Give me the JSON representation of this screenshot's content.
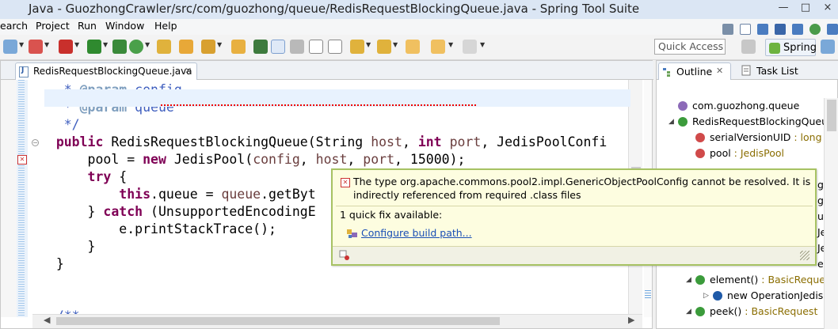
{
  "window": {
    "title": "Java - GuozhongCrawler/src/com/guozhong/queue/RedisRequestBlockingQueue.java - Spring Tool Suite",
    "min": "—",
    "max": "□",
    "close": "×"
  },
  "menu": {
    "items": [
      "earch",
      "Project",
      "Run",
      "Window",
      "Help"
    ]
  },
  "toolbar": {
    "quick_access": "Quick Access",
    "spring": "Spring"
  },
  "editor": {
    "tab_label": "RedisRequestBlockingQueue.java",
    "tab_close": "✕",
    "code_lines": [
      {
        "indent": "    ",
        "parts": [
          {
            "t": "* ",
            "c": "jd"
          },
          {
            "t": "@param",
            "c": "jdtag"
          },
          {
            "t": " config",
            "c": "jd"
          }
        ]
      },
      {
        "indent": "    ",
        "parts": [
          {
            "t": "* ",
            "c": "jd"
          },
          {
            "t": "@param",
            "c": "jdtag"
          },
          {
            "t": " queue",
            "c": "jd"
          }
        ]
      },
      {
        "indent": "    ",
        "parts": [
          {
            "t": "*/",
            "c": "jd"
          }
        ]
      },
      {
        "indent": "   ",
        "parts": [
          {
            "t": "public",
            "c": "kw"
          },
          {
            "t": " RedisRequestBlockingQueue(String ",
            "c": ""
          },
          {
            "t": "host",
            "c": "param"
          },
          {
            "t": ", ",
            "c": ""
          },
          {
            "t": "int",
            "c": "kw"
          },
          {
            "t": " ",
            "c": ""
          },
          {
            "t": "port",
            "c": "param"
          },
          {
            "t": ", JedisPoolConfi",
            "c": ""
          }
        ]
      },
      {
        "indent": "       ",
        "parts": [
          {
            "t": "pool = ",
            "c": ""
          },
          {
            "t": "new",
            "c": "kw"
          },
          {
            "t": " JedisPool(",
            "c": ""
          },
          {
            "t": "config",
            "c": "param"
          },
          {
            "t": ", ",
            "c": ""
          },
          {
            "t": "host",
            "c": "param"
          },
          {
            "t": ", ",
            "c": ""
          },
          {
            "t": "port",
            "c": "param"
          },
          {
            "t": ", 15000);",
            "c": ""
          }
        ]
      },
      {
        "indent": "       ",
        "parts": [
          {
            "t": "try",
            "c": "kw"
          },
          {
            "t": " {",
            "c": ""
          }
        ]
      },
      {
        "indent": "           ",
        "parts": [
          {
            "t": "this",
            "c": "kw"
          },
          {
            "t": ".queue = ",
            "c": ""
          },
          {
            "t": "queue",
            "c": "param"
          },
          {
            "t": ".getByt",
            "c": ""
          }
        ]
      },
      {
        "indent": "       ",
        "parts": [
          {
            "t": "} ",
            "c": ""
          },
          {
            "t": "catch",
            "c": "kw"
          },
          {
            "t": " (UnsupportedEncodingE",
            "c": ""
          }
        ]
      },
      {
        "indent": "           ",
        "parts": [
          {
            "t": "e.printStackTrace();",
            "c": ""
          }
        ]
      },
      {
        "indent": "       ",
        "parts": [
          {
            "t": "}",
            "c": ""
          }
        ]
      },
      {
        "indent": "   ",
        "parts": [
          {
            "t": "}",
            "c": ""
          }
        ]
      },
      {
        "indent": "",
        "parts": [
          {
            "t": "",
            "c": ""
          }
        ]
      },
      {
        "indent": "",
        "parts": [
          {
            "t": "",
            "c": ""
          }
        ]
      },
      {
        "indent": "   ",
        "parts": [
          {
            "t": "/**",
            "c": "jd"
          }
        ]
      }
    ]
  },
  "popup": {
    "message": "The type org.apache.commons.pool2.impl.GenericObjectPoolConfig cannot be resolved. It is indirectly referenced from required .class files",
    "quick_fix_count": "1 quick fix available:",
    "fix_label": "Configure build path..."
  },
  "outline": {
    "tab_label": "Outline",
    "tab_close": "✕",
    "tasklist_label": "Task List",
    "rows": [
      {
        "label": "com.guozhong.queue",
        "type": "",
        "indent": 0,
        "twisty": "",
        "icon": "#8c6ab8"
      },
      {
        "label": "RedisRequestBlockingQueue",
        "type": "",
        "indent": 0,
        "twisty": "◢",
        "icon": "#3b9b3b"
      },
      {
        "label": "serialVersionUID",
        "type": " : long",
        "indent": 1,
        "twisty": "",
        "icon": "#d04a4a"
      },
      {
        "label": "pool",
        "type": " : JedisPool",
        "indent": 1,
        "twisty": "",
        "icon": "#d04a4a"
      },
      {
        "label": "",
        "type": "",
        "indent": 1,
        "twisty": "",
        "icon": ""
      },
      {
        "label": "",
        "type": "",
        "indent": 1,
        "twisty": "",
        "icon": ""
      },
      {
        "label": "",
        "type": "",
        "indent": 1,
        "twisty": "",
        "icon": ""
      },
      {
        "label": "",
        "type": "",
        "indent": 1,
        "twisty": "",
        "icon": ""
      },
      {
        "label": "",
        "type": "",
        "indent": 1,
        "twisty": "",
        "icon": ""
      },
      {
        "label": "",
        "type": "",
        "indent": 1,
        "twisty": "",
        "icon": ""
      },
      {
        "label": "",
        "type": "",
        "indent": 1,
        "twisty": "",
        "icon": ""
      },
      {
        "label": "element()",
        "type": " : BasicRequest",
        "indent": 1,
        "twisty": "◢",
        "icon": "#3b9b3b"
      },
      {
        "label": "new OperationJedis()",
        "type": "",
        "indent": 2,
        "twisty": "▷",
        "icon": "#1f5aa8"
      },
      {
        "label": "peek()",
        "type": " : BasicRequest",
        "indent": 1,
        "twisty": "◢",
        "icon": "#3b9b3b"
      }
    ],
    "peeks": [
      "gQu",
      "gQu",
      "uest",
      "Jedis(",
      "Jedis(",
      "edis()"
    ]
  }
}
